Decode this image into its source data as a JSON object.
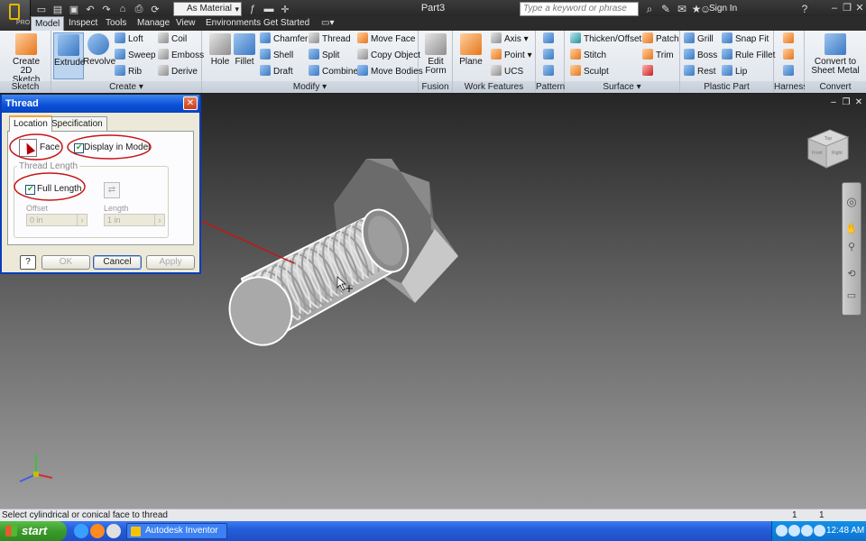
{
  "window": {
    "document_title": "Part3",
    "material": "As Material",
    "search_placeholder": "Type a keyword or phrase",
    "sign_in": "Sign In",
    "app_logo_text": "PRO"
  },
  "tabs": [
    {
      "label": "Model",
      "active": true
    },
    {
      "label": "Inspect"
    },
    {
      "label": "Tools"
    },
    {
      "label": "Manage"
    },
    {
      "label": "View"
    },
    {
      "label": "Environments"
    },
    {
      "label": "Get Started"
    }
  ],
  "ribbon": {
    "panels": {
      "sketch": "Sketch",
      "create": "Create",
      "modify": "Modify",
      "fusion": "Fusion",
      "work_features": "Work Features",
      "pattern": "Pattern",
      "surface": "Surface",
      "plastic_part": "Plastic Part",
      "harness": "Harness",
      "convert": "Convert"
    },
    "sketch": {
      "create_2d_sketch_line1": "Create",
      "create_2d_sketch_line2": "2D Sketch"
    },
    "create": {
      "extrude": "Extrude",
      "revolve": "Revolve",
      "loft": "Loft",
      "sweep": "Sweep",
      "rib": "Rib",
      "coil": "Coil",
      "emboss": "Emboss",
      "derive": "Derive"
    },
    "modify": {
      "hole": "Hole",
      "fillet": "Fillet",
      "chamfer": "Chamfer",
      "shell": "Shell",
      "draft": "Draft",
      "thread": "Thread",
      "split": "Split",
      "combine": "Combine",
      "move_face": "Move Face",
      "copy_object": "Copy Object",
      "move_bodies": "Move Bodies"
    },
    "fusion": {
      "edit_form_line1": "Edit",
      "edit_form_line2": "Form"
    },
    "work_features": {
      "plane": "Plane",
      "axis": "Axis",
      "point": "Point",
      "ucs": "UCS"
    },
    "surface": {
      "thicken_offset": "Thicken/Offset",
      "stitch": "Stitch",
      "sculpt": "Sculpt",
      "patch": "Patch",
      "trim": "Trim"
    },
    "plastic_part": {
      "grill": "Grill",
      "boss": "Boss",
      "rest": "Rest",
      "snap_fit": "Snap Fit",
      "rule_fillet": "Rule Fillet",
      "lip": "Lip"
    },
    "convert": {
      "line1": "Convert to",
      "line2": "Sheet Metal"
    }
  },
  "viewcube": {
    "front": "Front",
    "right": "Right",
    "top": "Top"
  },
  "thread_dialog": {
    "title": "Thread",
    "tabs": [
      "Location",
      "Specification"
    ],
    "face_label": "Face",
    "display_in_model_label": "Display in Model",
    "display_in_model_checked": true,
    "thread_length_group": "Thread Length",
    "full_length_label": "Full Length",
    "full_length_checked": true,
    "offset_label": "Offset",
    "offset_value": "0 in",
    "length_label": "Length",
    "length_value": "1 in",
    "help": "?",
    "ok": "OK",
    "cancel": "Cancel",
    "apply": "Apply"
  },
  "statusbar": {
    "prompt": "Select cylindrical or conical face to thread",
    "count1": "1",
    "count2": "1"
  },
  "taskbar": {
    "start": "start",
    "task_inventor": "Autodesk Inventor Pr...",
    "clock": "12:48 AM"
  },
  "colors": {
    "selection_highlight": "#ffffff",
    "annotation_red": "#c81414",
    "viewport_top": "#262626",
    "viewport_bottom": "#9e9e9e"
  }
}
